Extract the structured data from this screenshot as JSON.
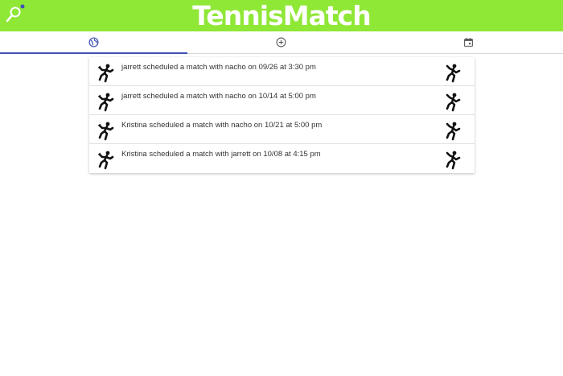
{
  "app": {
    "title": "TennisMatch",
    "accent_color": "#8fe736",
    "tab_indicator_color": "#3f51b5"
  },
  "tabs": [
    {
      "icon": "globe-icon",
      "active": true
    },
    {
      "icon": "add-circle-icon",
      "active": false
    },
    {
      "icon": "calendar-icon",
      "active": false
    }
  ],
  "feed": {
    "items": [
      {
        "text": "jarrett scheduled a match with nacho on 09/26 at 3:30 pm"
      },
      {
        "text": "jarrett scheduled a match with nacho on 10/14 at 5:00 pm"
      },
      {
        "text": "Kristina scheduled a match with nacho on 10/21 at 5:00 pm"
      },
      {
        "text": "Kristina scheduled a match with jarrett on 10/08 at 4:15 pm"
      }
    ]
  }
}
